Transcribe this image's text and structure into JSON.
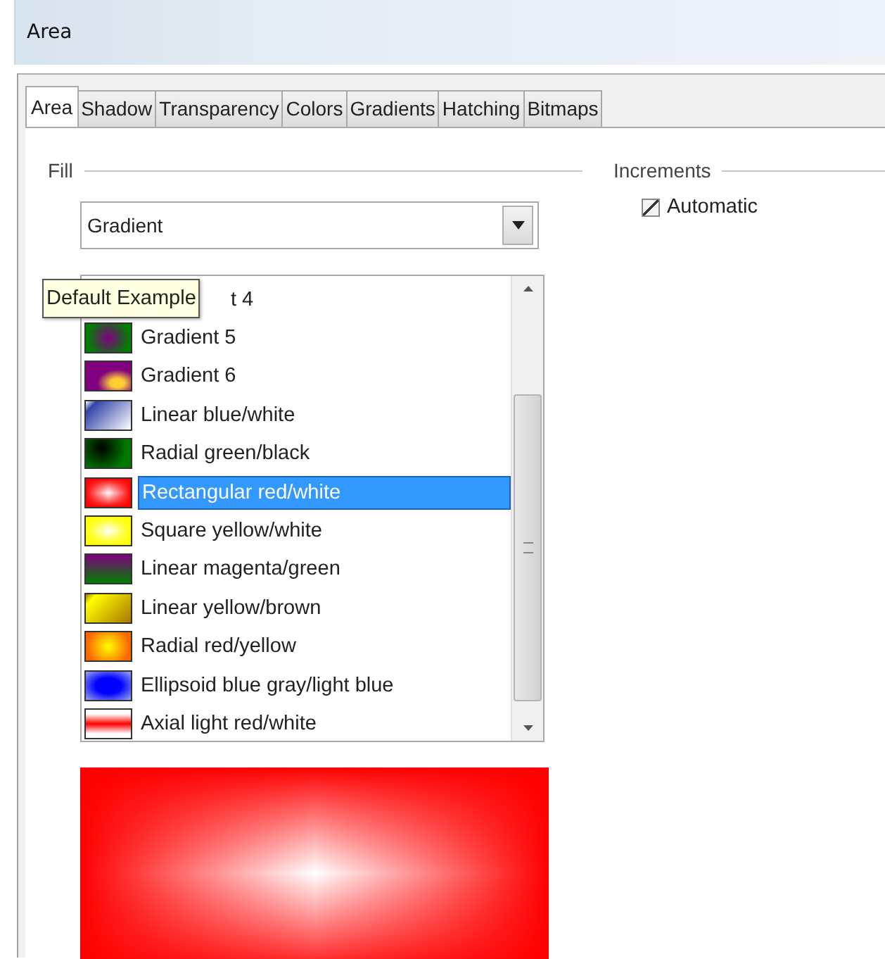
{
  "window": {
    "title": "Area"
  },
  "tabs": [
    {
      "label": "Area",
      "selected": true
    },
    {
      "label": "Shadow",
      "selected": false
    },
    {
      "label": "Transparency",
      "selected": false
    },
    {
      "label": "Colors",
      "selected": false
    },
    {
      "label": "Gradients",
      "selected": false
    },
    {
      "label": "Hatching",
      "selected": false
    },
    {
      "label": "Bitmaps",
      "selected": false
    }
  ],
  "fill": {
    "label": "Fill",
    "type": "Gradient",
    "items": [
      {
        "label": "t 4",
        "kind": "covered",
        "selected": false
      },
      {
        "label": "Gradient 5",
        "kind": "swatch",
        "selected": false
      },
      {
        "label": "Gradient 6",
        "kind": "swatch",
        "selected": false
      },
      {
        "label": "Linear blue/white",
        "kind": "swatch",
        "selected": false
      },
      {
        "label": "Radial green/black",
        "kind": "swatch",
        "selected": false
      },
      {
        "label": "Rectangular red/white",
        "kind": "swatch",
        "selected": true
      },
      {
        "label": "Square yellow/white",
        "kind": "swatch",
        "selected": false
      },
      {
        "label": "Linear magenta/green",
        "kind": "swatch",
        "selected": false
      },
      {
        "label": "Linear yellow/brown",
        "kind": "swatch",
        "selected": false
      },
      {
        "label": "Radial red/yellow",
        "kind": "swatch",
        "selected": false
      },
      {
        "label": "Ellipsoid blue gray/light blue",
        "kind": "swatch",
        "selected": false
      },
      {
        "label": "Axial light red/white",
        "kind": "swatch",
        "selected": false
      }
    ],
    "tooltip": "Default Example"
  },
  "increments": {
    "label": "Increments",
    "automatic": {
      "label": "Automatic",
      "checked": true
    }
  }
}
